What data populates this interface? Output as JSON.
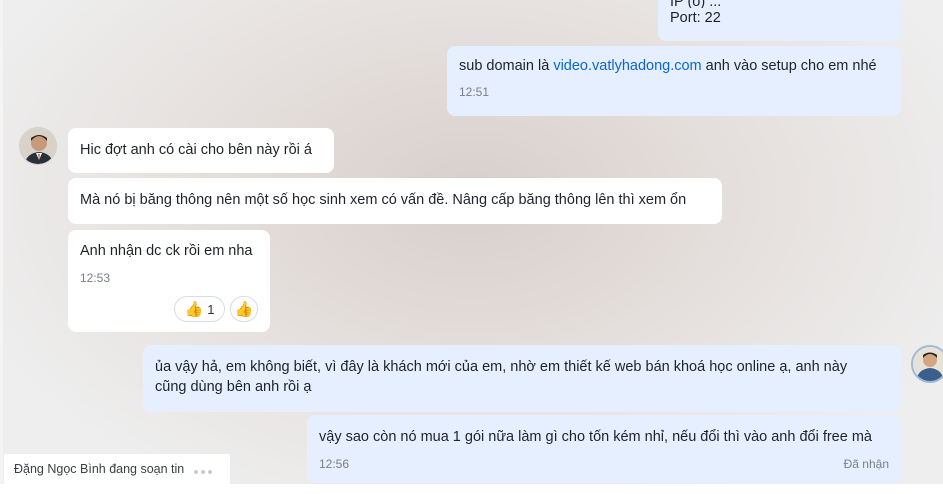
{
  "messages": {
    "server_info_partial": "IP (o) ... ",
    "server_info_port": "Port: 22",
    "subdomain_prefix": "sub domain là ",
    "subdomain_link": "video.vatlyhadong.com",
    "subdomain_suffix": " anh vào setup cho em nhé",
    "subdomain_time": "12:51",
    "reply1": "Hic đợt anh có cài cho bên này rồi á",
    "reply2": "Mà nó bị băng thông nên một số học sinh xem có vấn đề. Nâng cấp băng thông lên thì xem ổn",
    "reply3": "Anh nhận dc ck rồi em nha",
    "reply3_time": "12:53",
    "reaction_count": "1",
    "out1_line1": "ủa vậy hả, em không biết, vì đây là khách mới của em, nhờ em thiết kế web bán khoá học online ạ, anh này",
    "out1_line2": "cũng dùng bên anh rồi ạ",
    "out2": "vậy sao còn nó mua 1 gói nữa làm gì cho tốn kém nhỉ, nếu đổi thì vào anh đổi free mà",
    "out2_time": "12:56",
    "out2_status": "Đã nhận"
  },
  "typing_indicator": "Đặng Ngọc Bình đang soạn tin",
  "icons": {
    "reaction_emoji": "thumbs-up",
    "reaction_glyph": "👍"
  },
  "colors": {
    "incoming_bubble": "#ffffff",
    "outgoing_bubble": "#e5efff",
    "link": "#0a66d6"
  }
}
